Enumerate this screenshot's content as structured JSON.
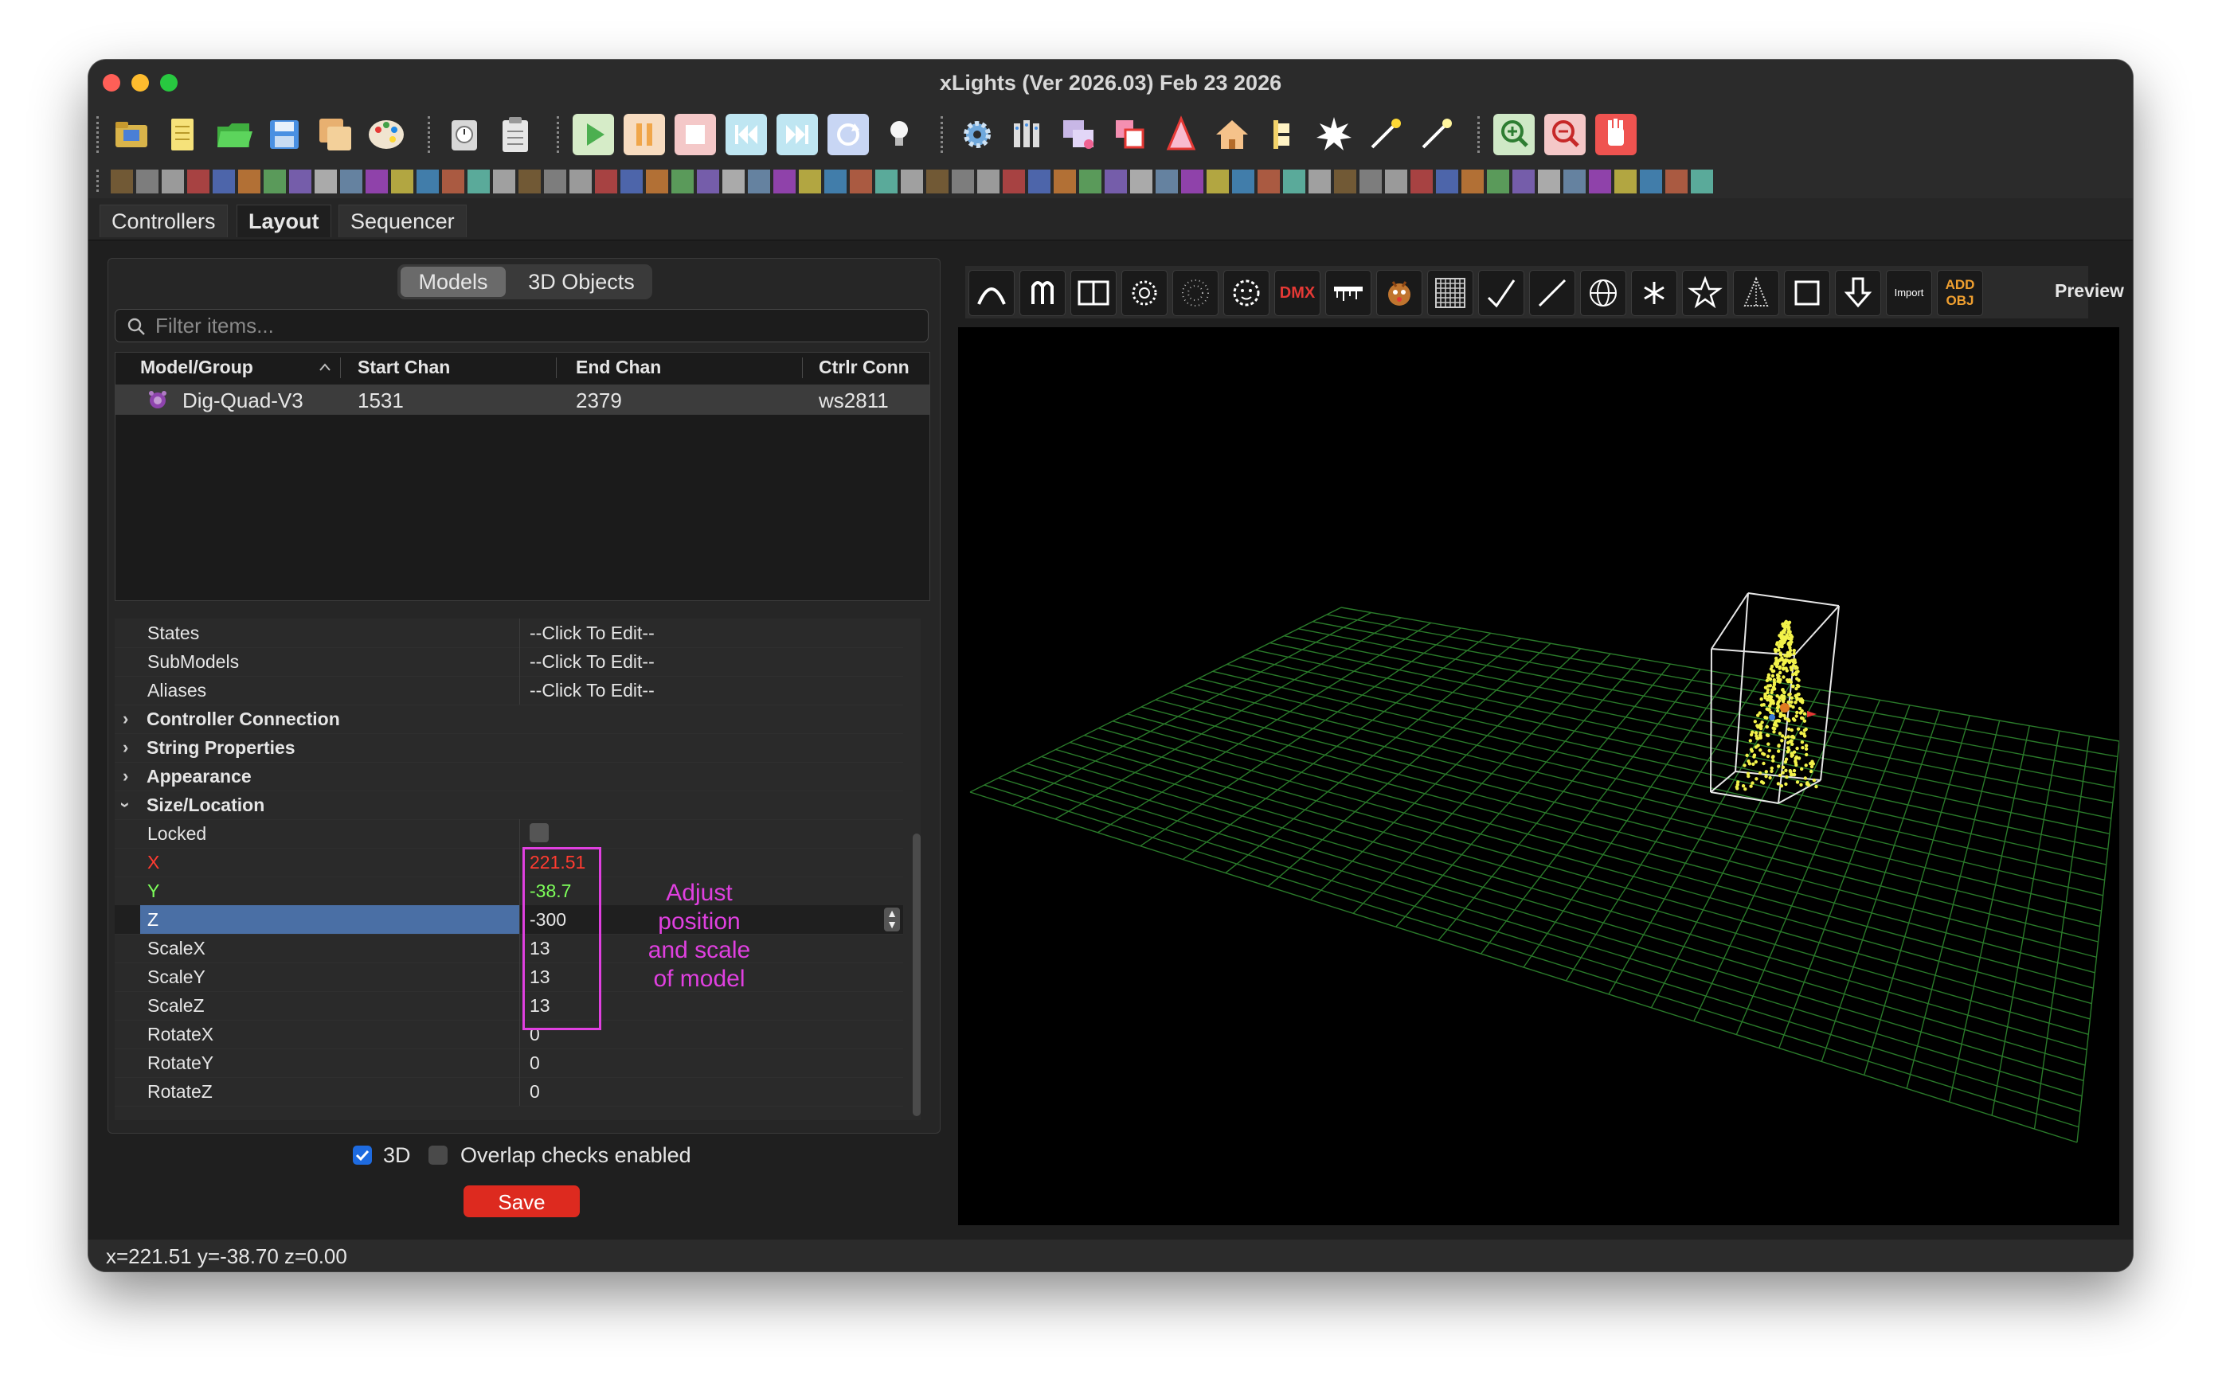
{
  "window": {
    "title": "xLights (Ver 2026.03) Feb 23 2026"
  },
  "tabs": [
    {
      "label": "Controllers"
    },
    {
      "label": "Layout"
    },
    {
      "label": "Sequencer"
    }
  ],
  "left_panel": {
    "segments": [
      {
        "label": "Models"
      },
      {
        "label": "3D Objects"
      }
    ],
    "filter_placeholder": "Filter items...",
    "columns": [
      "Model/Group",
      "Start Chan",
      "End Chan",
      "Ctrlr Conn"
    ],
    "rows": [
      {
        "name": "Dig-Quad-V3",
        "start": "1531",
        "end": "2379",
        "conn": "ws2811"
      }
    ]
  },
  "properties": {
    "states": {
      "label": "States",
      "value": "--Click To Edit--"
    },
    "submodels": {
      "label": "SubModels",
      "value": "--Click To Edit--"
    },
    "aliases": {
      "label": "Aliases",
      "value": "--Click To Edit--"
    },
    "controller_connection": "Controller Connection",
    "string_properties": "String Properties",
    "appearance": "Appearance",
    "size_location": "Size/Location",
    "locked": "Locked",
    "x": {
      "label": "X",
      "value": "221.51"
    },
    "y": {
      "label": "Y",
      "value": "-38.7"
    },
    "z": {
      "label": "Z",
      "value": "-300"
    },
    "scalex": {
      "label": "ScaleX",
      "value": "13"
    },
    "scaley": {
      "label": "ScaleY",
      "value": "13"
    },
    "scalez": {
      "label": "ScaleZ",
      "value": "13"
    },
    "rotatex": {
      "label": "RotateX",
      "value": "0"
    },
    "rotatey": {
      "label": "RotateY",
      "value": "0"
    },
    "rotatez": {
      "label": "RotateZ",
      "value": "0"
    }
  },
  "annotation": [
    "Adjust",
    "position",
    "and scale",
    "of model"
  ],
  "bottom": {
    "three_d": {
      "label": "3D",
      "checked": true
    },
    "overlap": {
      "label": "Overlap checks enabled",
      "checked": false
    },
    "save": "Save"
  },
  "layout_toolbar": {
    "dmx_label": "DMX",
    "import_label": "Import",
    "add_obj_label_1": "ADD",
    "add_obj_label_2": "OBJ"
  },
  "preview": {
    "label": "Preview"
  },
  "status": {
    "coords": "x=221.51 y=-38.70 z=0.00"
  },
  "colors": {
    "accent_red": "#ff3b30",
    "accent_green": "#7dff5a",
    "annotation_magenta": "#e040e0",
    "save_button": "#dd2a1f",
    "grid_green": "#2a7a2a",
    "lights_yellow": "#f2f24a"
  }
}
